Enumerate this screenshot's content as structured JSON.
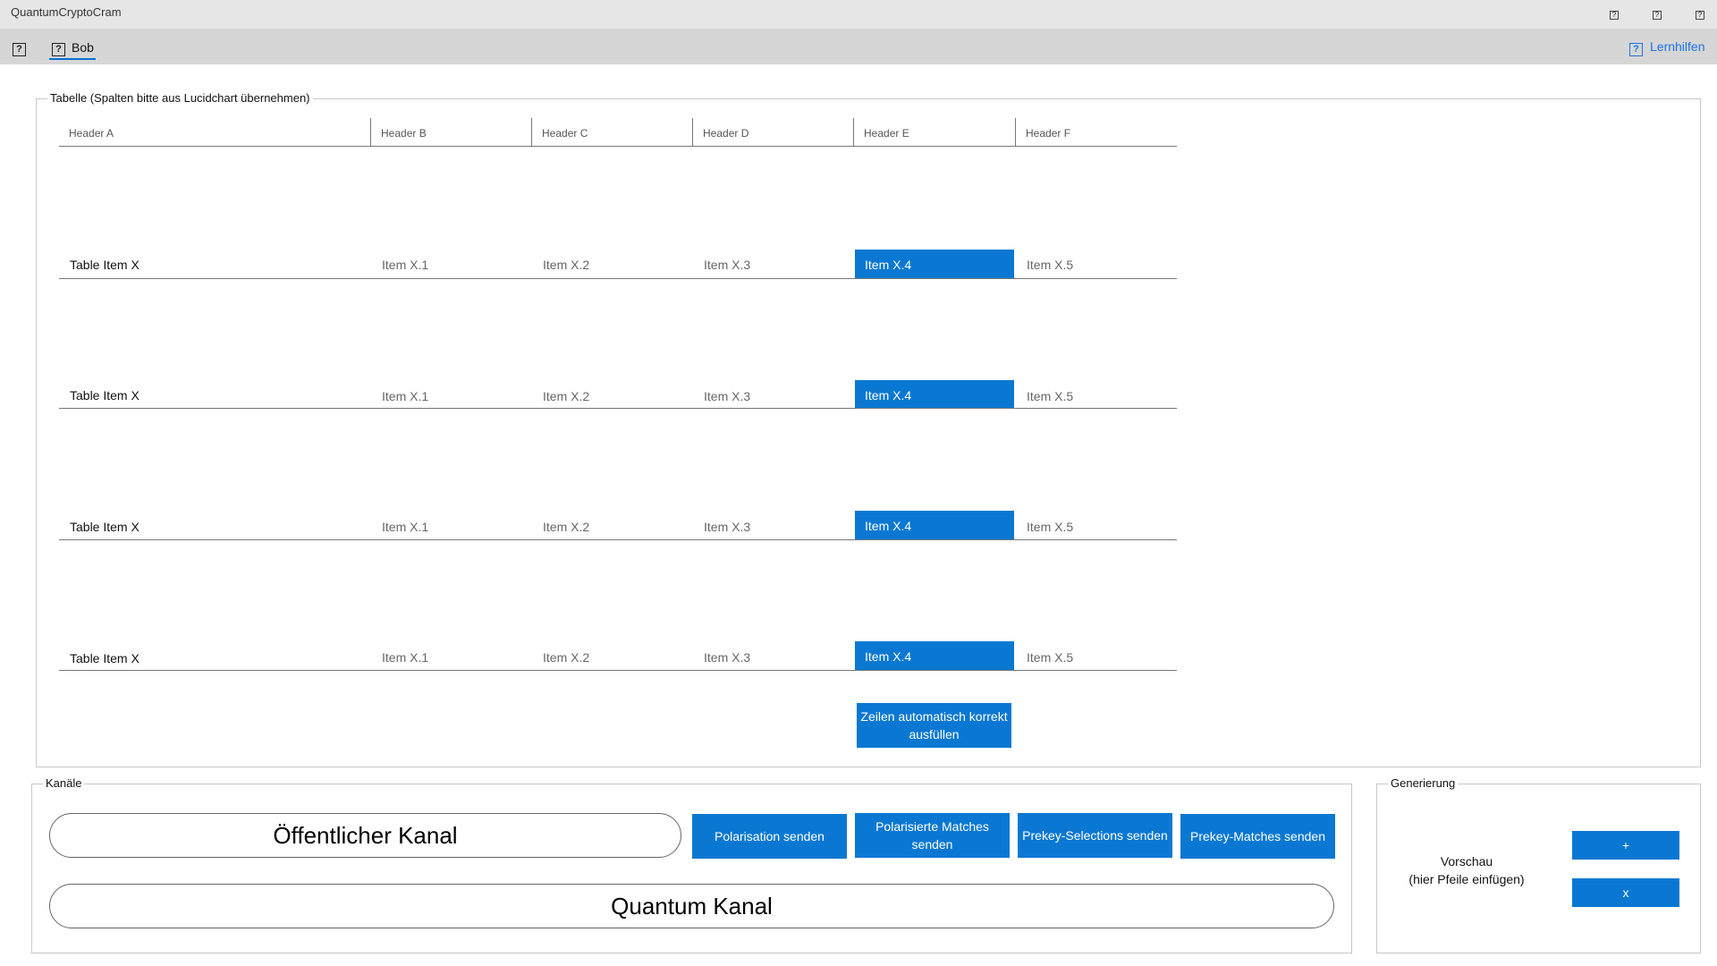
{
  "app": {
    "title": "QuantumCryptoCram"
  },
  "window_controls": [
    {
      "name": "minimize-button",
      "icon": "help-square-icon",
      "glyph": "?"
    },
    {
      "name": "maximize-button",
      "icon": "help-square-icon",
      "glyph": "?"
    },
    {
      "name": "close-button",
      "icon": "help-square-icon",
      "glyph": "?"
    }
  ],
  "toolbar": {
    "help_glyph": "?",
    "tab_bob": {
      "label": "Bob",
      "glyph": "?"
    },
    "lernhilfen": {
      "label": "Lernhilfen",
      "glyph": "?"
    }
  },
  "table": {
    "group_label": "Tabelle (Spalten bitte aus Lucidchart übernehmen)",
    "headers": [
      "Header A",
      "Header B",
      "Header C",
      "Header D",
      "Header E",
      "Header F"
    ],
    "rows": [
      [
        "Table Item X",
        "Item X.1",
        "Item X.2",
        "Item X.3",
        "Item X.4",
        "Item X.5"
      ],
      [
        "Table Item X",
        "Item X.1",
        "Item X.2",
        "Item X.3",
        "Item X.4",
        "Item X.5"
      ],
      [
        "Table Item X",
        "Item X.1",
        "Item X.2",
        "Item X.3",
        "Item X.4",
        "Item X.5"
      ],
      [
        "Table Item X",
        "Item X.1",
        "Item X.2",
        "Item X.3",
        "Item X.4",
        "Item X.5"
      ]
    ],
    "highlight_column": 4,
    "autofill_button": "Zeilen automatisch korrekt ausfüllen"
  },
  "channels": {
    "group_label": "Kanäle",
    "public_channel": "Öffentlicher Kanal",
    "quantum_channel": "Quantum Kanal",
    "buttons": [
      "Polarisation senden",
      "Polarisierte Matches senden",
      "Prekey-Selections senden",
      "Prekey-Matches senden"
    ]
  },
  "generation": {
    "group_label": "Generierung",
    "preview_line1": "Vorschau",
    "preview_line2": "(hier Pfeile einfügen)",
    "plus_button": "+",
    "x_button": "x"
  },
  "colors": {
    "accent": "#0a78d2",
    "link": "#1a73e8",
    "titlebar": "#e6e6e6",
    "toolbar": "#d6d6d6"
  }
}
